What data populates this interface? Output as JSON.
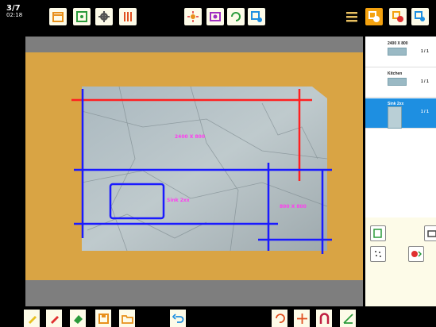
{
  "status": {
    "line1": "3/7",
    "line2": "02:18"
  },
  "top_toolbar": {
    "icons": [
      "calendar-icon",
      "settings-box-icon",
      "gear-icon",
      "sliders-icon",
      "sun-icon",
      "camera-icon",
      "rotate-icon",
      "layout-settings-icon",
      "menu-icon",
      "add-piece-icon",
      "remove-piece-icon",
      "piece-icon"
    ]
  },
  "canvas": {
    "labels": {
      "main_piece": "2400 X 800",
      "sink_cutout": "Sink 2xx",
      "side_piece": "800 X 800"
    }
  },
  "piece_list": {
    "items": [
      {
        "name": "2400 X 800",
        "qty": "1 / 1"
      },
      {
        "name": "Kitchen",
        "qty": "1 / 1"
      },
      {
        "name": "Sink 2xx",
        "qty": "1 / 1",
        "selected": true
      }
    ]
  },
  "right_tools": [
    "piece-add-icon",
    "print-icon",
    "pattern-icon",
    "cutout-icon"
  ],
  "bottom_toolbar": {
    "icons": [
      "pencil-yellow-icon",
      "pencil-red-icon",
      "eraser-icon",
      "save-icon",
      "folder-icon",
      "undo-icon",
      "rotate-icon",
      "move-icon",
      "magnet-icon",
      "angle-icon"
    ]
  },
  "colors": {
    "board": "#d9a444",
    "cut_red": "#ff2020",
    "cut_blue": "#1a1aff",
    "label_magenta": "#ff3cf0",
    "selected": "#1e8fe1",
    "accent_orange": "#f4a20f"
  }
}
